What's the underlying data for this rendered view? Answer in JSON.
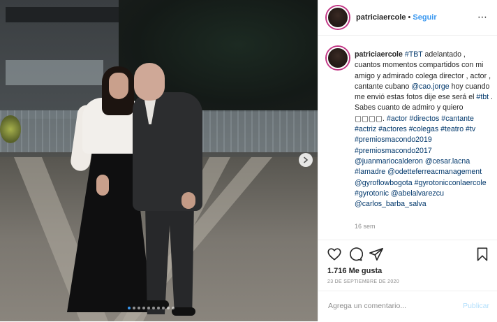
{
  "post": {
    "username": "patriciaercole",
    "separator": "•",
    "follow_label": "Seguir",
    "more_icon": "⋯",
    "caption_user": "patriciaercole",
    "caption_text": "#TBT adelantado , cuantos momentos compartidos con mi amigo y admirado colega director , actor , cantante cubano @cao.jorge hoy cuando me envió estas fotos dije ese será el #tbt . Sabes cuanto de admiro y quiero ▢▢▢▢. #actor #directos #cantante #actriz #actores #colegas #teatro #tv #premiosmacondo2019 #premiosmacondo2017 @juanmariocalderon @cesar.lacna #lamadre @odetteferreacmanagement @gyroflowbogota #gyrotonicconlaercole #gyrotonic @abelalvarezcu @carlos_barba_salva",
    "time_ago": "16 sem",
    "likes_label": "1.716 Me gusta",
    "date_label": "23 DE SEPTIEMBRE DE 2020",
    "comment_placeholder": "Agrega un comentario...",
    "publish_label": "Publicar"
  },
  "carousel": {
    "total": 10,
    "active": 0
  },
  "icons": {
    "like": "heart-icon",
    "comment": "comment-icon",
    "share": "share-icon",
    "save": "bookmark-icon",
    "next": "chevron-right-icon"
  },
  "colors": {
    "link": "#00376b",
    "accent": "#3897f0",
    "muted": "#8e8e8e",
    "disabled": "#b2dffc"
  }
}
